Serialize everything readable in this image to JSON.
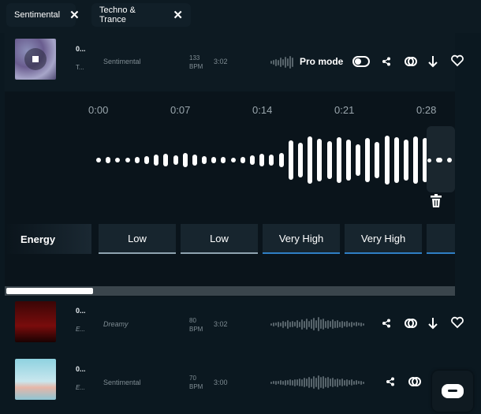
{
  "tags": [
    {
      "label": "Sentimental"
    },
    {
      "label": "Techno & Trance"
    }
  ],
  "tracks": [
    {
      "title": "0...",
      "artist": "T...",
      "mood": "Sentimental",
      "bpm": "133",
      "bpm_unit": "BPM",
      "duration": "3:02",
      "pro_mode_label": "Pro mode"
    },
    {
      "title": "0...",
      "artist": "E...",
      "mood": "Dreamy",
      "bpm": "80",
      "bpm_unit": "BPM",
      "duration": "3:02"
    },
    {
      "title": "0...",
      "artist": "E...",
      "mood": "Sentimental",
      "bpm": "70",
      "bpm_unit": "BPM",
      "duration": "3:00"
    }
  ],
  "timeline": [
    "0:00",
    "0:07",
    "0:14",
    "0:21",
    "0:28"
  ],
  "energy": {
    "label": "Energy",
    "cells": [
      "Low",
      "Low",
      "Very High",
      "Very High"
    ]
  },
  "colors": {
    "accent_blue": "#2f7fc4",
    "background": "#0b1820"
  },
  "scroll": {
    "horizontal_position_fraction": 0.0
  }
}
